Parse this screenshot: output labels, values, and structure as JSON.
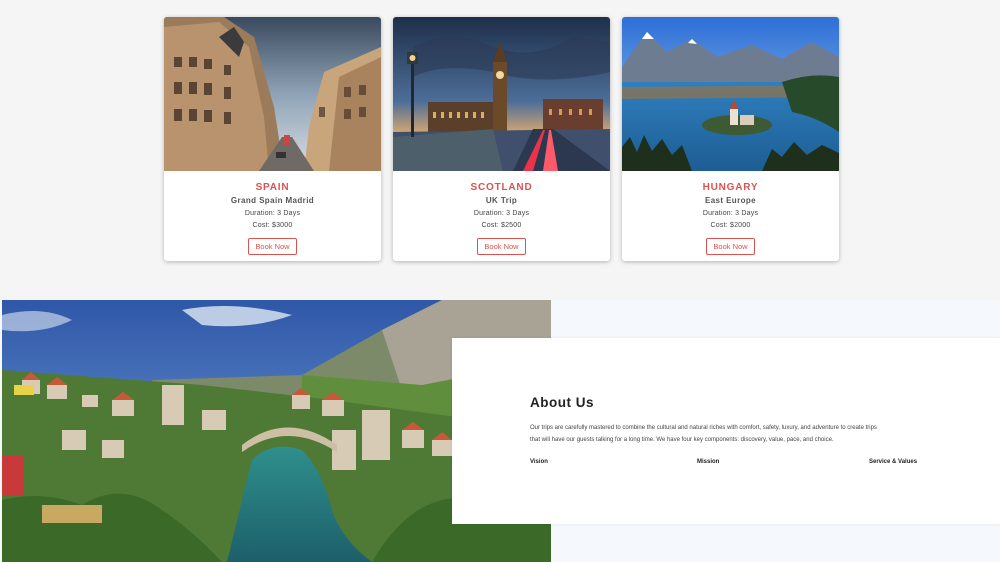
{
  "tours": [
    {
      "country": "SPAIN",
      "subtitle": "Grand Spain Madrid",
      "duration": "Duration: 3 Days",
      "cost": "Cost: $3000",
      "button": "Book Now"
    },
    {
      "country": "SCOTLAND",
      "subtitle": "UK Trip",
      "duration": "Duration: 3 Days",
      "cost": "Cost: $2500",
      "button": "Book Now"
    },
    {
      "country": "HUNGARY",
      "subtitle": "East Europe",
      "duration": "Duration: 3 Days",
      "cost": "Cost: $2000",
      "button": "Book Now"
    }
  ],
  "about": {
    "title": "About Us",
    "text_line1": "Our trips are carefully mastered to combine the cultural and natural riches with comfort, safety, luxury, and adventure to create trips",
    "text_line2": "that will have our guests talking for a long time. We have four key components: discovery, value, pace, and choice.",
    "pillars": [
      "Vision",
      "Mission",
      "Service & Values"
    ]
  },
  "colors": {
    "accent": "#d9534f",
    "page_bg": "#f5f5f5",
    "about_bg": "#f5f8fc"
  }
}
